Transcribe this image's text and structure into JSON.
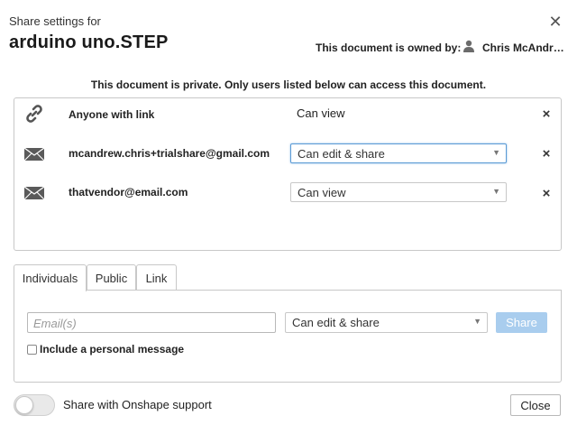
{
  "dialog": {
    "subtitle": "Share settings for",
    "document_title": "arduino uno.STEP",
    "close_glyph": "✕",
    "owner_label": "This document is owned by:",
    "owner_name": "Chris McAndrew",
    "owner_icon": "person-icon",
    "private_note": "This document is private. Only users listed below can access this document."
  },
  "share_list": [
    {
      "icon": "link-icon",
      "name": "Anyone with link",
      "permission": "Can view",
      "is_dropdown": false,
      "remove_glyph": "×"
    },
    {
      "icon": "envelope-icon",
      "name": "mcandrew.chris+trialshare@gmail.com",
      "permission": "Can edit & share",
      "is_dropdown": true,
      "remove_glyph": "×"
    },
    {
      "icon": "envelope-icon",
      "name": "thatvendor@email.com",
      "permission": "Can view",
      "is_dropdown": true,
      "remove_glyph": "×"
    }
  ],
  "tabs": [
    {
      "label": "Individuals",
      "active": true
    },
    {
      "label": "Public",
      "active": false
    },
    {
      "label": "Link",
      "active": false
    }
  ],
  "invite": {
    "email_placeholder": "Email(s)",
    "permission": "Can edit & share",
    "share_label": "Share",
    "personal_message_label": "Include a personal message",
    "personal_message_checked": false
  },
  "footer": {
    "support_toggle_label": "Share with Onshape support",
    "support_toggle_on": false,
    "close_label": "Close"
  },
  "colors": {
    "share_button_disabled": "#a9cdee",
    "focus_border": "#5b9bd5"
  }
}
